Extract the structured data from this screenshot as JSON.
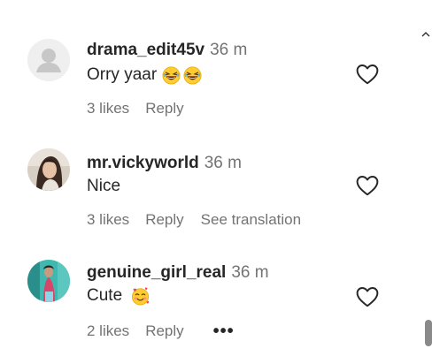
{
  "comments": [
    {
      "username": "drama_edit45v",
      "time": "36 m",
      "text": "Orry yaar",
      "emojis": [
        "grinning-squinting-tears-emoji",
        "grinning-squinting-tears-emoji"
      ],
      "likes": "3 likes",
      "reply": "Reply",
      "avatar": "default-avatar"
    },
    {
      "username": "mr.vickyworld",
      "time": "36 m",
      "text": "Nice",
      "emojis": [],
      "likes": "3 likes",
      "reply": "Reply",
      "see_translation": "See translation",
      "avatar": "photo-avatar"
    },
    {
      "username": "genuine_girl_real",
      "time": "36 m",
      "text": "Cute",
      "emojis": [
        "smiling-face-with-hearts-emoji"
      ],
      "likes": "2 likes",
      "reply": "Reply",
      "more": "•••",
      "avatar": "photo-avatar"
    }
  ],
  "icons": {
    "like": "heart-outline-icon",
    "scroll_up": "chevron-up-icon"
  },
  "colors": {
    "text": "#262626",
    "secondary": "#737373",
    "background": "#ffffff"
  }
}
